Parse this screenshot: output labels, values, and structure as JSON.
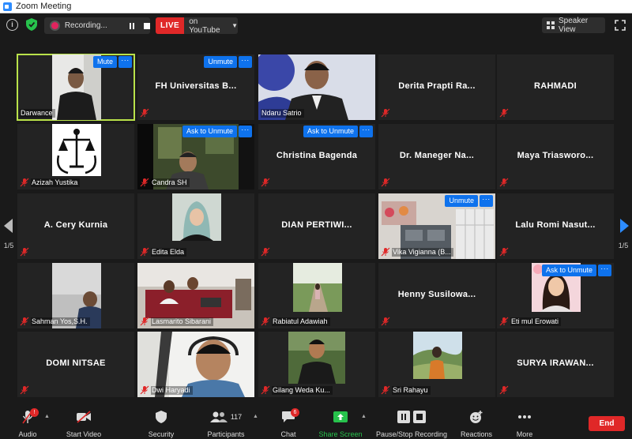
{
  "window": {
    "title": "Zoom Meeting"
  },
  "topbar": {
    "info_symbol": "i",
    "recording_label": "Recording...",
    "live_tag": "LIVE",
    "live_target": "on YouTube",
    "view_label": "Speaker View"
  },
  "grid": {
    "tiles": [
      {
        "label": "Darwance",
        "overlay_button": "Mute",
        "dots": "···"
      },
      {
        "name": "FH Universitas B...",
        "overlay_button": "Unmute",
        "dots": "···"
      },
      {
        "label": "Ndaru Satrio"
      },
      {
        "name": "Derita Prapti Ra..."
      },
      {
        "name": "RAHMADI"
      },
      {
        "label": "Azizah Yustika"
      },
      {
        "label": "Candra SH",
        "overlay_button": "Ask to Unmute",
        "dots": "···"
      },
      {
        "name": "Christina Bagenda",
        "overlay_button": "Ask to Unmute",
        "dots": "···"
      },
      {
        "name": "Dr. Maneger Na..."
      },
      {
        "name": "Maya Triasworo..."
      },
      {
        "name": "A. Cery Kurnia"
      },
      {
        "label": "Edita Elda"
      },
      {
        "name": "DIAN PERTIWI..."
      },
      {
        "label": "Vika Vigianna (B...",
        "overlay_button": "Unmute",
        "dots": "···"
      },
      {
        "name": "Lalu Romi Nasut..."
      },
      {
        "label": "Sahman Yos,S.H."
      },
      {
        "label": "Lasmarito Sibarani"
      },
      {
        "label": "Rabiatul Adawiah"
      },
      {
        "name": "Henny Susilowa..."
      },
      {
        "label": "Eti mul Erowati",
        "overlay_button": "Ask to Unmute",
        "dots": "···"
      },
      {
        "name": "DOMI NITSAE"
      },
      {
        "label": "Dwi Haryadi"
      },
      {
        "label": "Gilang Weda Ku..."
      },
      {
        "label": "Sri Rahayu"
      },
      {
        "name": "SURYA IRAWAN..."
      }
    ]
  },
  "pager": {
    "left": "1/5",
    "right": "1/5"
  },
  "toolbar": {
    "audio": "Audio",
    "audio_badge": "!",
    "start_video": "Start Video",
    "security": "Security",
    "participants": "Participants",
    "participants_count": "117",
    "chat": "Chat",
    "chat_badge": "6",
    "share_screen": "Share Screen",
    "pause_stop_recording": "Pause/Stop Recording",
    "reactions": "Reactions",
    "more": "More",
    "end": "End"
  },
  "colors": {
    "accent_blue": "#0e72ed",
    "active_speaker": "#b9e24a",
    "live_red": "#e02828",
    "share_green": "#27c24c",
    "muted_red": "#e02828"
  }
}
